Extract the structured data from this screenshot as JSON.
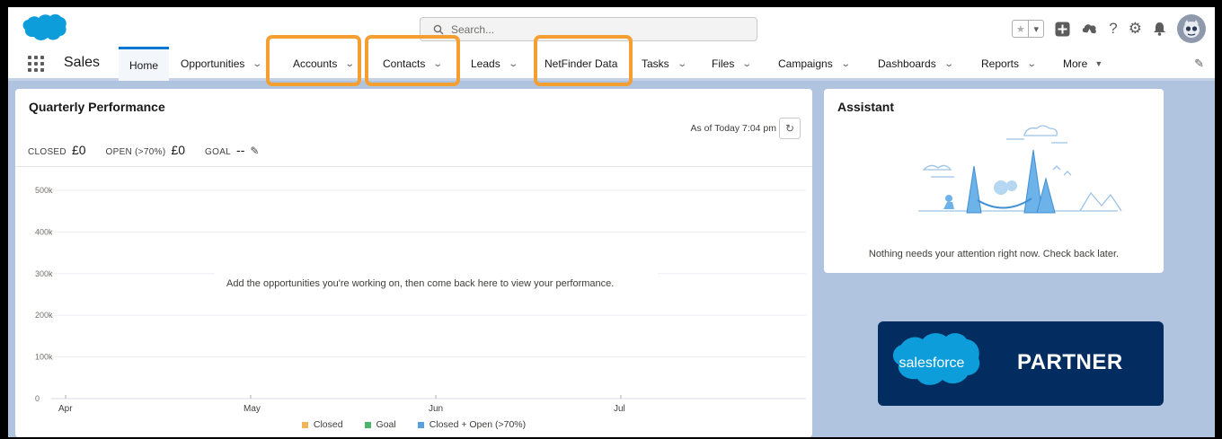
{
  "header": {
    "search_placeholder": "Search..."
  },
  "nav": {
    "app_name": "Sales",
    "tabs": [
      {
        "label": "Home",
        "chevron": false
      },
      {
        "label": "Opportunities",
        "chevron": true
      },
      {
        "label": "Accounts",
        "chevron": true
      },
      {
        "label": "Contacts",
        "chevron": true
      },
      {
        "label": "Leads",
        "chevron": true
      },
      {
        "label": "NetFinder Data",
        "chevron": false
      },
      {
        "label": "Tasks",
        "chevron": true
      },
      {
        "label": "Files",
        "chevron": true
      },
      {
        "label": "Campaigns",
        "chevron": true
      },
      {
        "label": "Dashboards",
        "chevron": true
      },
      {
        "label": "Reports",
        "chevron": true
      },
      {
        "label": "More",
        "chevron": true
      }
    ],
    "highlighted_tabs": [
      "Accounts",
      "Contacts",
      "NetFinder Data"
    ],
    "highlight_color": "#f59f32"
  },
  "performance": {
    "title": "Quarterly Performance",
    "as_of": "As of Today 7:04 pm",
    "closed_label": "CLOSED",
    "closed_value": "£0",
    "open_label": "OPEN (>70%)",
    "open_value": "£0",
    "goal_label": "GOAL",
    "goal_value": "--",
    "empty_message": "Add the opportunities you're working on, then come back here to view your performance."
  },
  "chart_data": {
    "type": "line",
    "x_ticks": [
      "Apr",
      "May",
      "Jun",
      "Jul"
    ],
    "y_ticks": [
      "0",
      "100k",
      "200k",
      "300k",
      "400k",
      "500k"
    ],
    "ylim": [
      0,
      500000
    ],
    "grid": true,
    "legend_placement": "bottom-center",
    "series": [
      {
        "name": "Closed",
        "color": "#f0b35a",
        "values": []
      },
      {
        "name": "Goal",
        "color": "#4bb56b",
        "values": []
      },
      {
        "name": "Closed + Open (>70%)",
        "color": "#5aa0e0",
        "values": []
      }
    ]
  },
  "assistant": {
    "title": "Assistant",
    "message": "Nothing needs your attention right now. Check back later."
  },
  "partner": {
    "brand": "salesforce",
    "label": "PARTNER",
    "background": "#032d60"
  },
  "icons": [
    "salesforce-logo",
    "search-icon",
    "favorite-star-icon",
    "favorites-dropdown-icon",
    "global-actions-icon",
    "trailhead-icon",
    "help-icon",
    "setup-gear-icon",
    "notification-bell-icon",
    "user-avatar",
    "app-launcher-icon",
    "edit-nav-icon",
    "pencil-icon",
    "refresh-icon"
  ]
}
